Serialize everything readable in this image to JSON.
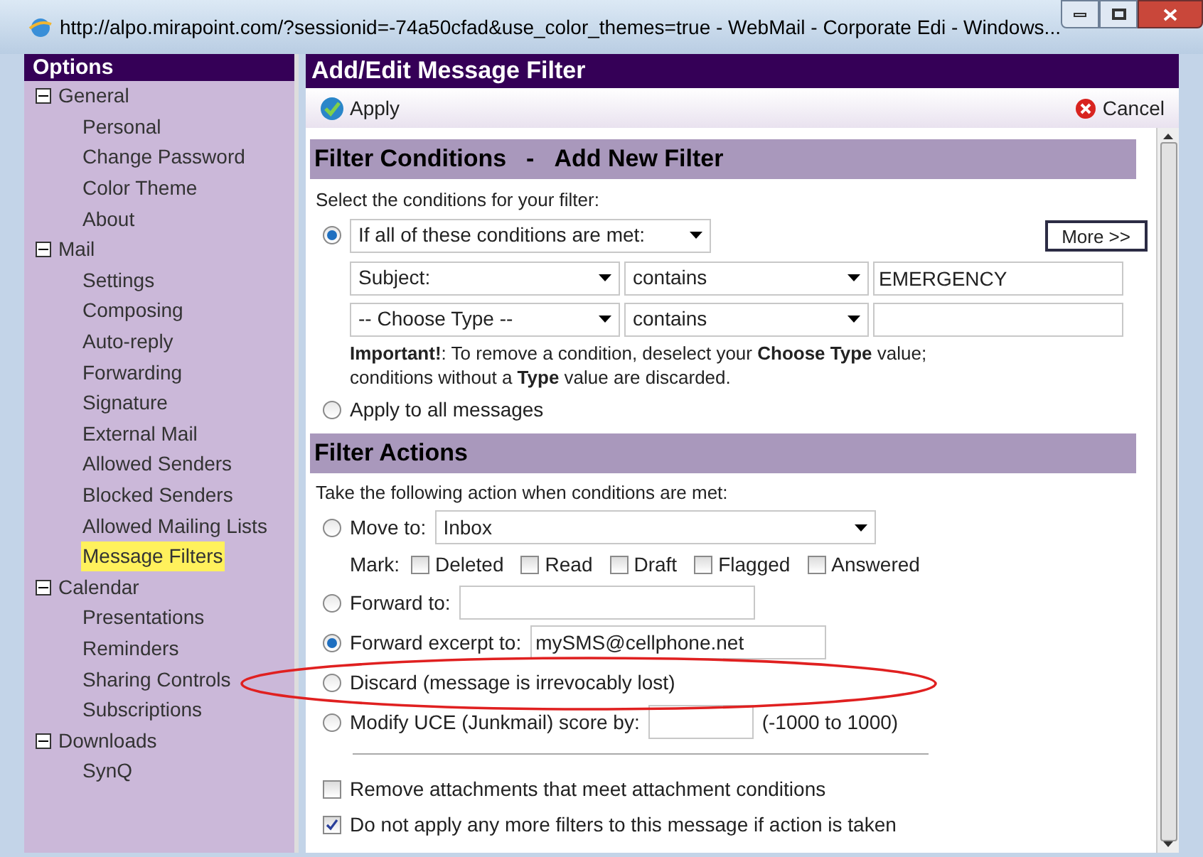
{
  "window": {
    "title": "http://alpo.mirapoint.com/?sessionid=-74a50cfad&use_color_themes=true - WebMail - Corporate Edi - Windows..."
  },
  "sidebar": {
    "title": "Options",
    "groups": [
      {
        "label": "General",
        "expanded": true,
        "children": [
          {
            "label": "Personal",
            "selected": false
          },
          {
            "label": "Change Password",
            "selected": false
          },
          {
            "label": "Color Theme",
            "selected": false
          },
          {
            "label": "About",
            "selected": false
          }
        ]
      },
      {
        "label": "Mail",
        "expanded": true,
        "children": [
          {
            "label": "Settings",
            "selected": false
          },
          {
            "label": "Composing",
            "selected": false
          },
          {
            "label": "Auto-reply",
            "selected": false
          },
          {
            "label": "Forwarding",
            "selected": false
          },
          {
            "label": "Signature",
            "selected": false
          },
          {
            "label": "External Mail",
            "selected": false
          },
          {
            "label": "Allowed Senders",
            "selected": false
          },
          {
            "label": "Blocked Senders",
            "selected": false
          },
          {
            "label": "Allowed Mailing Lists",
            "selected": false
          },
          {
            "label": "Message Filters",
            "selected": true
          }
        ]
      },
      {
        "label": "Calendar",
        "expanded": true,
        "children": [
          {
            "label": "Presentations",
            "selected": false
          },
          {
            "label": "Reminders",
            "selected": false
          },
          {
            "label": "Sharing Controls",
            "selected": false
          },
          {
            "label": "Subscriptions",
            "selected": false
          }
        ]
      },
      {
        "label": "Downloads",
        "expanded": true,
        "children": [
          {
            "label": "SynQ",
            "selected": false
          }
        ]
      }
    ]
  },
  "main": {
    "title": "Add/Edit Message Filter",
    "apply": "Apply",
    "cancel": "Cancel",
    "conditions": {
      "title": "Filter Conditions",
      "subtitle": "Add New Filter",
      "separator": "-",
      "intro": "Select the conditions for your filter:",
      "match_selected": true,
      "match": "If all of these conditions are met:",
      "more": "More >>",
      "rows": [
        {
          "field": "Subject:",
          "operator": "contains",
          "value": "EMERGENCY"
        },
        {
          "field": "-- Choose Type --",
          "operator": "contains",
          "value": ""
        }
      ],
      "note": "**Important!**: To remove a condition, deselect your **Choose Type** value;",
      "note2": "conditions without a **Type** value are discarded.",
      "all_selected": false,
      "all": "Apply to all messages"
    },
    "actions": {
      "title": "Filter Actions",
      "intro": "Take the following action when conditions are met:",
      "items": [
        {
          "kind": "select",
          "label": "Move to:",
          "value": "Inbox",
          "selected": false
        },
        {
          "kind": "marks",
          "label": "Mark:",
          "marks": [
            {
              "label": "Deleted",
              "checked": false
            },
            {
              "label": "Read",
              "checked": false
            },
            {
              "label": "Draft",
              "checked": false
            },
            {
              "label": "Flagged",
              "checked": false
            },
            {
              "label": "Answered",
              "checked": false
            }
          ]
        },
        {
          "kind": "input",
          "label": "Forward to:",
          "value": "",
          "selected": false
        },
        {
          "kind": "input",
          "label": "Forward excerpt to:",
          "value": "mySMS@cellphone.net",
          "selected": true
        },
        {
          "kind": "plain",
          "label": "Discard (message is irrevocably lost)",
          "selected": false
        },
        {
          "kind": "score",
          "label": "Modify UCE (Junkmail) score by:",
          "value": "",
          "hint": "(-1000 to 1000)",
          "selected": false
        }
      ],
      "options": [
        {
          "label": "Remove attachments that meet attachment conditions",
          "checked": false
        },
        {
          "label": "Do not apply any more filters to this message if action is taken",
          "checked": true
        }
      ]
    }
  }
}
